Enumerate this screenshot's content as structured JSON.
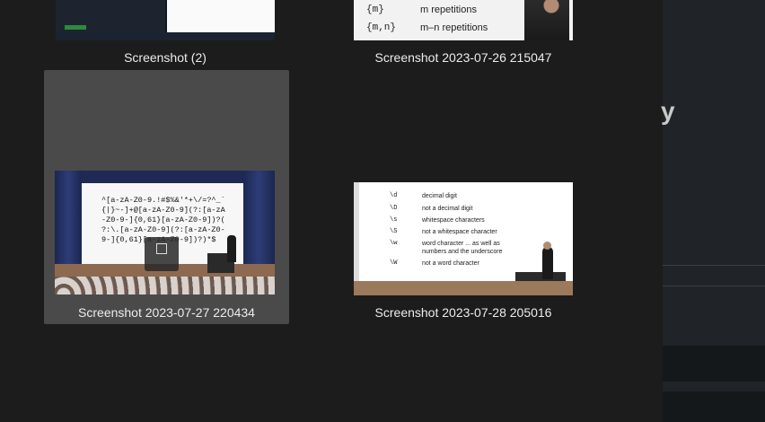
{
  "files": [
    {
      "caption": "Screenshot (2)",
      "icon": "image-thumbnail"
    },
    {
      "caption": "Screenshot 2023-07-26 215047",
      "icon": "image-thumbnail",
      "slide_rows": [
        {
          "key": "{m}",
          "desc": "m repetitions"
        },
        {
          "key": "{m,n}",
          "desc": "m–n repetitions"
        }
      ]
    },
    {
      "caption": "Screenshot 2023-07-27 220434",
      "icon": "image-thumbnail",
      "selected": true,
      "slide_code": "^[a-zA-Z0-9.!#$%&'*+\\/=?^_`\n{|}~-]+@[a-zA-Z0-9](?:[a-zA\n-Z0-9-]{0,61}[a-zA-Z0-9])?(\n?:\\.[a-zA-Z0-9](?:[a-zA-Z0-\n9-]{0,61}[a-zA-Z0-9])?)*$"
    },
    {
      "caption": "Screenshot 2023-07-28 205016",
      "icon": "image-thumbnail",
      "slide_rows": [
        {
          "key": "\\d",
          "desc": "decimal digit"
        },
        {
          "key": "\\D",
          "desc": "not a decimal digit"
        },
        {
          "key": "\\s",
          "desc": "whitespace characters"
        },
        {
          "key": "\\S",
          "desc": "not a whitespace character"
        },
        {
          "key": "\\w",
          "desc": "word character ... as well as numbers and the underscore"
        },
        {
          "key": "\\W",
          "desc": "not a word character"
        }
      ]
    }
  ],
  "side_pane": {
    "partial_text": "y"
  }
}
